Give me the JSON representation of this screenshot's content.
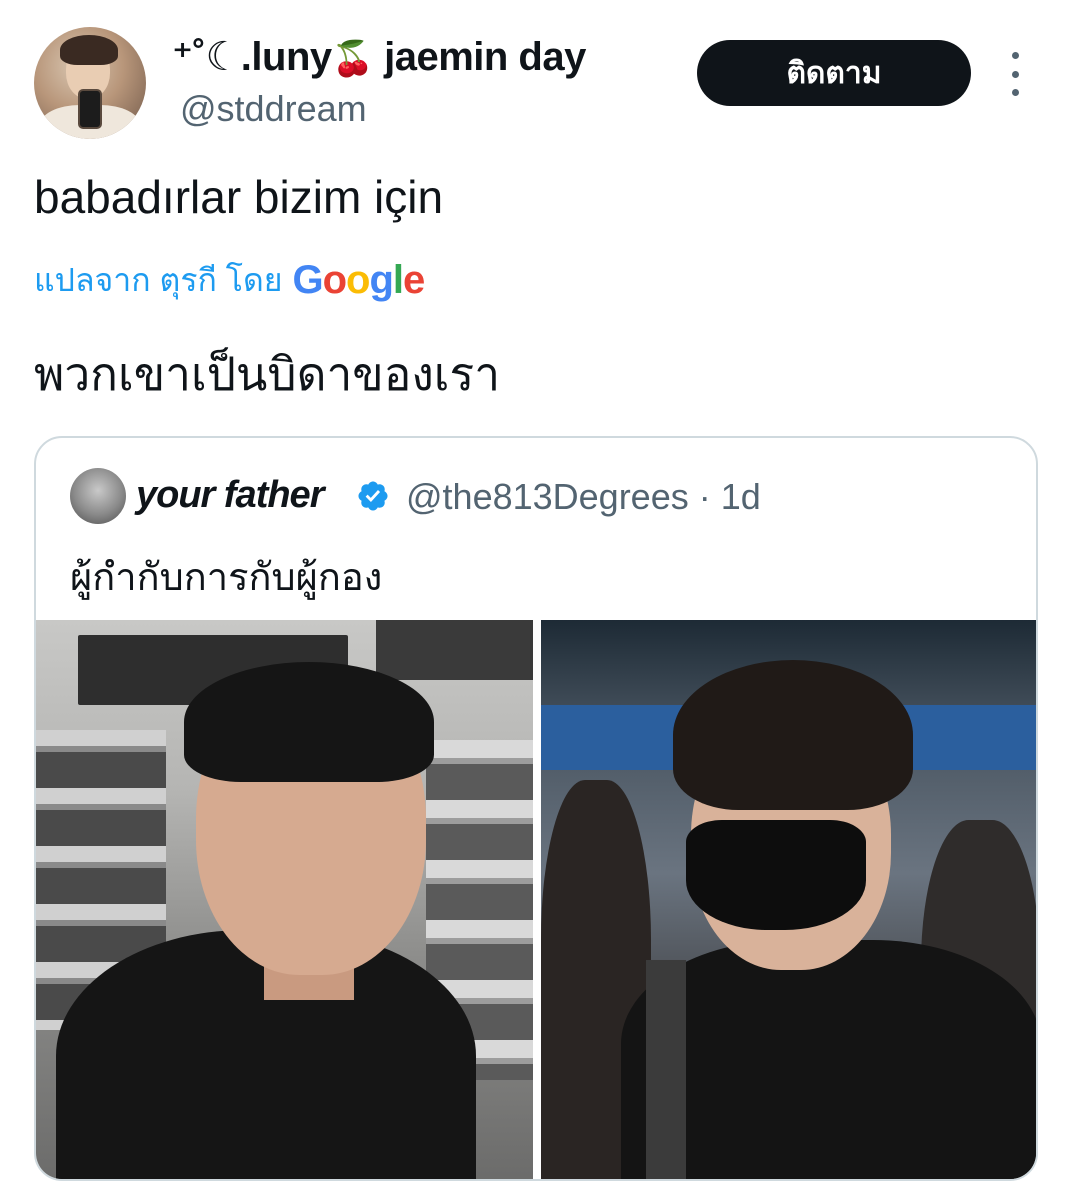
{
  "author": {
    "display_name_pre": "⁺˚☾.luny",
    "display_name_emoji": "🍒",
    "display_name_post": " jaemin day",
    "handle": "@stddream",
    "avatar_icon": "profile-photo"
  },
  "follow_button": {
    "label": "ติดตาม"
  },
  "tweet": {
    "text": "babadırlar bizim için",
    "translate_label": "แปลจาก ตุรกี โดย",
    "translated_text": "พวกเขาเป็นบิดาของเรา"
  },
  "google_logo": {
    "letters": [
      "G",
      "o",
      "o",
      "g",
      "l",
      "e"
    ]
  },
  "quote": {
    "display_name": "your father",
    "handle_time": "@the813Degrees · 1d",
    "text": "ผู้กำกับการกับผู้กอง",
    "verified_color": "#1d9bf0"
  },
  "colors": {
    "text_primary": "#0f1419",
    "text_secondary": "#536471",
    "link": "#1d9bf0",
    "button_bg": "#0f1419"
  }
}
